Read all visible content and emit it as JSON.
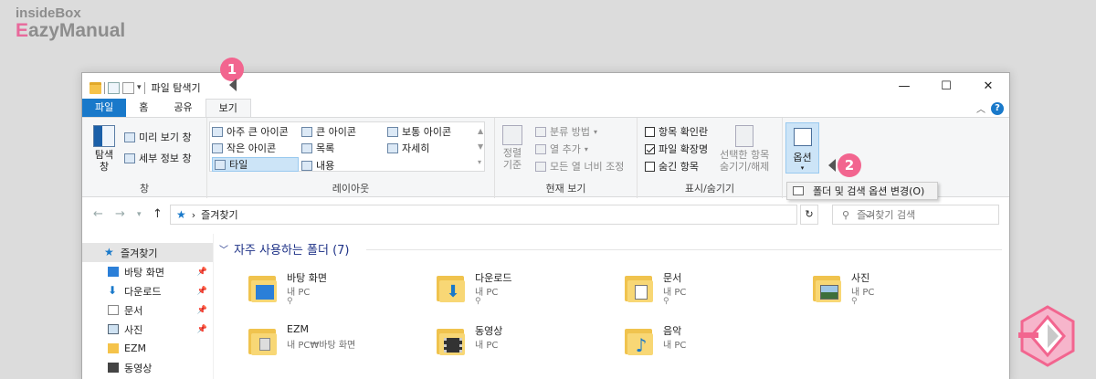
{
  "brand": {
    "top": "insideBox",
    "bottom_e": "E",
    "bottom_rest": "azyManual"
  },
  "window": {
    "title": "파일 탐색기",
    "min": "—",
    "max": "☐",
    "close": "✕"
  },
  "tabs": [
    "파일",
    "홈",
    "공유",
    "보기"
  ],
  "ribbon": {
    "pane_group": {
      "label": "창",
      "nav_pane": "탐색\n창",
      "preview": "미리 보기 창",
      "details": "세부 정보 창"
    },
    "layout_group": {
      "label": "레이아웃",
      "items": [
        "아주 큰 아이콘",
        "큰 아이콘",
        "보통 아이콘",
        "작은 아이콘",
        "목록",
        "자세히",
        "타일",
        "내용"
      ]
    },
    "view_group": {
      "label": "현재 보기",
      "sort": "정렬\n기준",
      "group_by": "분류 방법",
      "add_col": "열 추가",
      "fit_col": "모든 열 너비 조정"
    },
    "show_group": {
      "label": "표시/숨기기",
      "item_check": "항목 확인란",
      "extensions": "파일 확장명",
      "hidden": "숨긴 항목",
      "hide_sel": "선택한 항목\n숨기기/해제"
    },
    "options": {
      "label": "옵션",
      "menu_item": "폴더 및 검색 옵션 변경(O)"
    }
  },
  "address": {
    "path": "즐겨찾기",
    "search_placeholder": "즐겨찾기 검색"
  },
  "nav": [
    {
      "label": "즐겨찾기",
      "pinned": false,
      "selected": true,
      "icon": "star-icon"
    },
    {
      "label": "바탕 화면",
      "pinned": true,
      "icon": "desktop-icon"
    },
    {
      "label": "다운로드",
      "pinned": true,
      "icon": "download-icon"
    },
    {
      "label": "문서",
      "pinned": true,
      "icon": "document-icon"
    },
    {
      "label": "사진",
      "pinned": true,
      "icon": "picture-icon"
    },
    {
      "label": "EZM",
      "pinned": false,
      "icon": "folder-icon"
    },
    {
      "label": "동영상",
      "pinned": false,
      "icon": "video-icon"
    }
  ],
  "section": {
    "title": "자주 사용하는 폴더 (7)"
  },
  "folders": [
    {
      "name": "바탕 화면",
      "sub": "내 PC",
      "pinned": true,
      "icon": "desktop-folder-icon"
    },
    {
      "name": "다운로드",
      "sub": "내 PC",
      "pinned": true,
      "icon": "download-folder-icon"
    },
    {
      "name": "문서",
      "sub": "내 PC",
      "pinned": true,
      "icon": "document-folder-icon"
    },
    {
      "name": "사진",
      "sub": "내 PC",
      "pinned": true,
      "icon": "picture-folder-icon"
    },
    {
      "name": "EZM",
      "sub": "내 PC₩바탕 화면",
      "pinned": false,
      "icon": "folder-icon"
    },
    {
      "name": "동영상",
      "sub": "내 PC",
      "pinned": false,
      "icon": "video-folder-icon"
    },
    {
      "name": "음악",
      "sub": "내 PC",
      "pinned": false,
      "icon": "music-folder-icon"
    }
  ],
  "markers": {
    "one": "1",
    "two": "2"
  },
  "colors": {
    "accent": "#1979ca",
    "marker": "#f2658f",
    "section_title": "#1e3287"
  }
}
